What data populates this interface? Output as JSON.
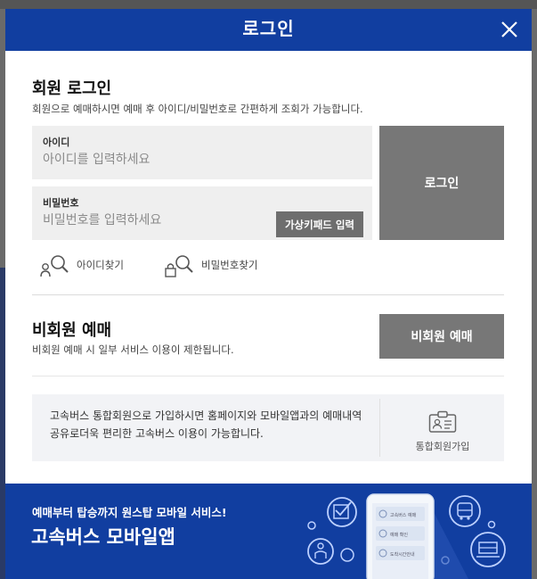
{
  "modal": {
    "title": "로그인",
    "close_icon": "close-icon"
  },
  "member_login": {
    "title": "회원 로그인",
    "description": "회원으로 예매하시면 예매 후 아이디/비밀번호로 간편하게 조회가 가능합니다.",
    "id_field": {
      "label": "아이디",
      "placeholder": "아이디를 입력하세요",
      "value": ""
    },
    "pw_field": {
      "label": "비밀번호",
      "placeholder": "비밀번호를 입력하세요",
      "value": ""
    },
    "virtual_keypad_label": "가상키패드 입력",
    "login_button_label": "로그인",
    "find_id_label": "아이디찾기",
    "find_pw_label": "비밀번호찾기"
  },
  "guest": {
    "title": "비회원 예매",
    "description": "비회원 예매 시 일부 서비스 이용이 제한됩니다.",
    "button_label": "비회원 예매"
  },
  "info": {
    "text": "고속버스 통합회원으로 가입하시면 홈페이지와 모바일앱과의 예매내역 공유로더욱 편리한 고속버스 이용이 가능합니다.",
    "join_label": "통합회원가입"
  },
  "banner": {
    "subtitle": "예매부터 탑승까지 원스탑 모바일 서비스!",
    "title": "고속버스 모바일앱",
    "phone_items": [
      "고속버스 예매",
      "예매 확인",
      "도착시간안내"
    ]
  },
  "colors": {
    "brand": "#113ea0",
    "button_gray": "#777777"
  }
}
